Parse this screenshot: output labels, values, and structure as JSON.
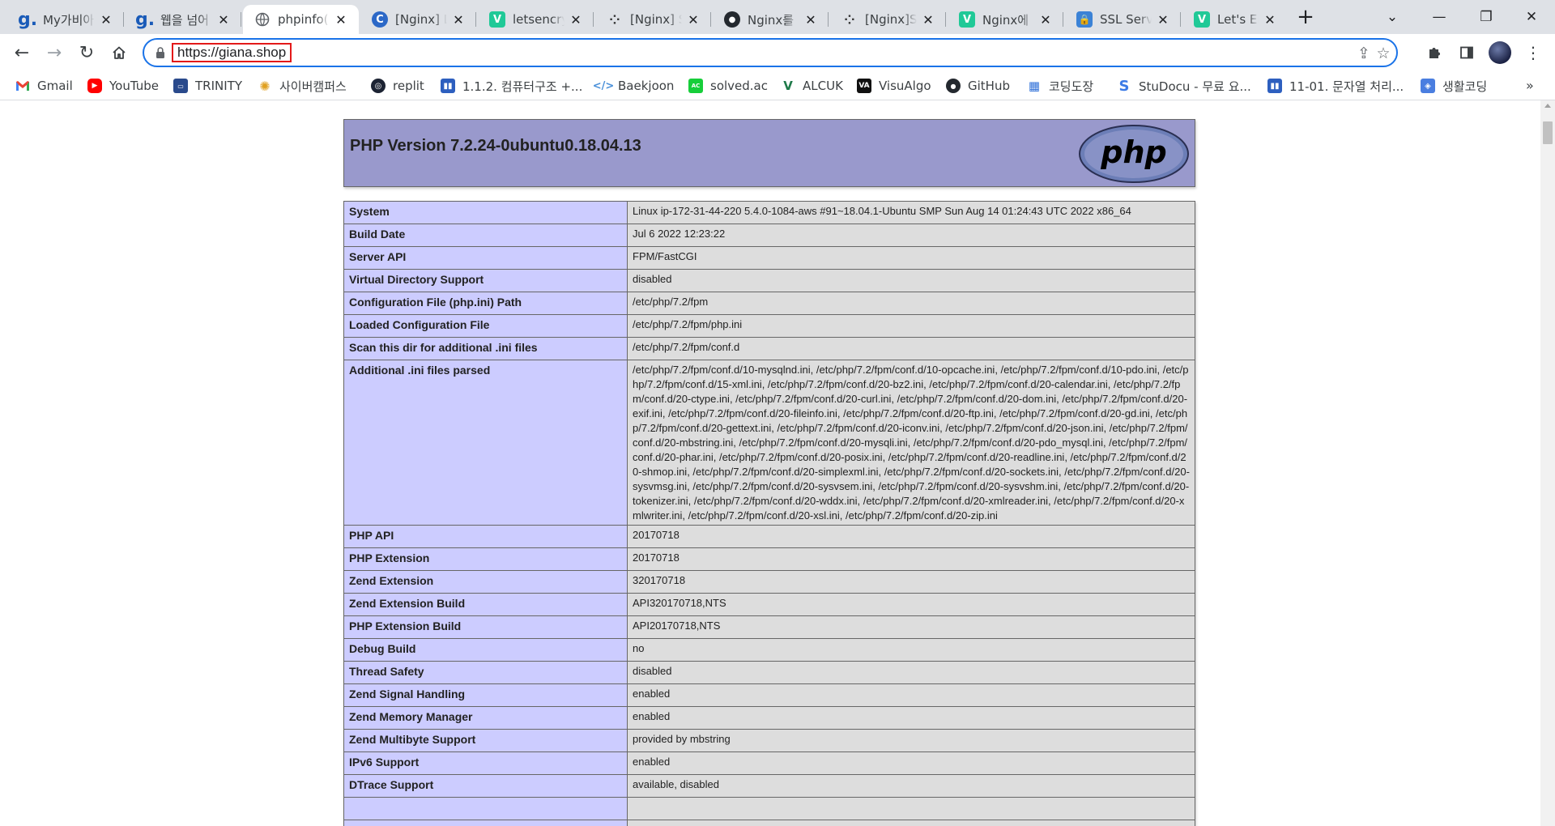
{
  "browser": {
    "tabs": [
      {
        "title": "My가비아",
        "icon": "gabia-icon",
        "active": false
      },
      {
        "title": "웹을 넘어",
        "icon": "gabia-icon",
        "active": false
      },
      {
        "title": "phpinfo()",
        "icon": "globe-icon",
        "active": true
      },
      {
        "title": "[Nginx] Let's",
        "icon": "c-icon",
        "active": false
      },
      {
        "title": "letsencrypt",
        "icon": "velog-icon",
        "active": false
      },
      {
        "title": "[Nginx] SSL",
        "icon": "dots-icon",
        "active": false
      },
      {
        "title": "Nginx를",
        "icon": "github-icon",
        "active": false
      },
      {
        "title": "[Nginx]SSL",
        "icon": "dots-icon",
        "active": false
      },
      {
        "title": "Nginx에",
        "icon": "velog-icon",
        "active": false
      },
      {
        "title": "SSL Server",
        "icon": "lock-icon",
        "active": false
      },
      {
        "title": "Let's Encrypt",
        "icon": "velog-icon",
        "active": false
      }
    ],
    "url": "https://giana.shop",
    "bookmarks": [
      {
        "label": "Gmail",
        "icon": "gmail-icon"
      },
      {
        "label": "YouTube",
        "icon": "youtube-icon"
      },
      {
        "label": "TRINITY",
        "icon": "trinity-icon"
      },
      {
        "label": "사이버캠퍼스",
        "icon": "campus-icon"
      },
      {
        "label": "replit",
        "icon": "replit-icon"
      },
      {
        "label": "1.1.2. 컴퓨터구조 +...",
        "icon": "bookmark-icon"
      },
      {
        "label": "Baekjoon",
        "icon": "code-icon"
      },
      {
        "label": "solved.ac",
        "icon": "solvedac-icon"
      },
      {
        "label": "ALCUK",
        "icon": "alcuk-icon"
      },
      {
        "label": "VisuAlgo",
        "icon": "visualgo-icon"
      },
      {
        "label": "GitHub",
        "icon": "github-icon"
      },
      {
        "label": "코딩도장",
        "icon": "dojang-icon"
      },
      {
        "label": "StuDocu - 무료 요...",
        "icon": "studocu-icon"
      },
      {
        "label": "11-01. 문자열 처리...",
        "icon": "bookmark-icon"
      },
      {
        "label": "생활코딩",
        "icon": "opentutorials-icon"
      }
    ]
  },
  "page": {
    "title": "PHP Version 7.2.24-0ubuntu0.18.04.13",
    "logo_text": "php",
    "rows": [
      {
        "key": "System",
        "value": "Linux ip-172-31-44-220 5.4.0-1084-aws #91~18.04.1-Ubuntu SMP Sun Aug 14 01:24:43 UTC 2022 x86_64"
      },
      {
        "key": "Build Date",
        "value": "Jul 6 2022 12:23:22"
      },
      {
        "key": "Server API",
        "value": "FPM/FastCGI"
      },
      {
        "key": "Virtual Directory Support",
        "value": "disabled"
      },
      {
        "key": "Configuration File (php.ini) Path",
        "value": "/etc/php/7.2/fpm"
      },
      {
        "key": "Loaded Configuration File",
        "value": "/etc/php/7.2/fpm/php.ini"
      },
      {
        "key": "Scan this dir for additional .ini files",
        "value": "/etc/php/7.2/fpm/conf.d"
      },
      {
        "key": "Additional .ini files parsed",
        "value": "/etc/php/7.2/fpm/conf.d/10-mysqlnd.ini, /etc/php/7.2/fpm/conf.d/10-opcache.ini, /etc/php/7.2/fpm/conf.d/10-pdo.ini, /etc/php/7.2/fpm/conf.d/15-xml.ini, /etc/php/7.2/fpm/conf.d/20-bz2.ini, /etc/php/7.2/fpm/conf.d/20-calendar.ini, /etc/php/7.2/fpm/conf.d/20-ctype.ini, /etc/php/7.2/fpm/conf.d/20-curl.ini, /etc/php/7.2/fpm/conf.d/20-dom.ini, /etc/php/7.2/fpm/conf.d/20-exif.ini, /etc/php/7.2/fpm/conf.d/20-fileinfo.ini, /etc/php/7.2/fpm/conf.d/20-ftp.ini, /etc/php/7.2/fpm/conf.d/20-gd.ini, /etc/php/7.2/fpm/conf.d/20-gettext.ini, /etc/php/7.2/fpm/conf.d/20-iconv.ini, /etc/php/7.2/fpm/conf.d/20-json.ini, /etc/php/7.2/fpm/conf.d/20-mbstring.ini, /etc/php/7.2/fpm/conf.d/20-mysqli.ini, /etc/php/7.2/fpm/conf.d/20-pdo_mysql.ini, /etc/php/7.2/fpm/conf.d/20-phar.ini, /etc/php/7.2/fpm/conf.d/20-posix.ini, /etc/php/7.2/fpm/conf.d/20-readline.ini, /etc/php/7.2/fpm/conf.d/20-shmop.ini, /etc/php/7.2/fpm/conf.d/20-simplexml.ini, /etc/php/7.2/fpm/conf.d/20-sockets.ini, /etc/php/7.2/fpm/conf.d/20-sysvmsg.ini, /etc/php/7.2/fpm/conf.d/20-sysvsem.ini, /etc/php/7.2/fpm/conf.d/20-sysvshm.ini, /etc/php/7.2/fpm/conf.d/20-tokenizer.ini, /etc/php/7.2/fpm/conf.d/20-wddx.ini, /etc/php/7.2/fpm/conf.d/20-xmlreader.ini, /etc/php/7.2/fpm/conf.d/20-xmlwriter.ini, /etc/php/7.2/fpm/conf.d/20-xsl.ini, /etc/php/7.2/fpm/conf.d/20-zip.ini"
      },
      {
        "key": "PHP API",
        "value": "20170718"
      },
      {
        "key": "PHP Extension",
        "value": "20170718"
      },
      {
        "key": "Zend Extension",
        "value": "320170718"
      },
      {
        "key": "Zend Extension Build",
        "value": "API320170718,NTS"
      },
      {
        "key": "PHP Extension Build",
        "value": "API20170718,NTS"
      },
      {
        "key": "Debug Build",
        "value": "no"
      },
      {
        "key": "Thread Safety",
        "value": "disabled"
      },
      {
        "key": "Zend Signal Handling",
        "value": "enabled"
      },
      {
        "key": "Zend Memory Manager",
        "value": "enabled"
      },
      {
        "key": "Zend Multibyte Support",
        "value": "provided by mbstring"
      },
      {
        "key": "IPv6 Support",
        "value": "enabled"
      },
      {
        "key": "DTrace Support",
        "value": "available, disabled"
      }
    ]
  },
  "colors": {
    "header_bg": "#9999cc",
    "key_cell_bg": "#ccccff",
    "value_cell_bg": "#dddddd",
    "url_highlight": "#e31919",
    "omnibox_focus": "#1a73e8"
  }
}
